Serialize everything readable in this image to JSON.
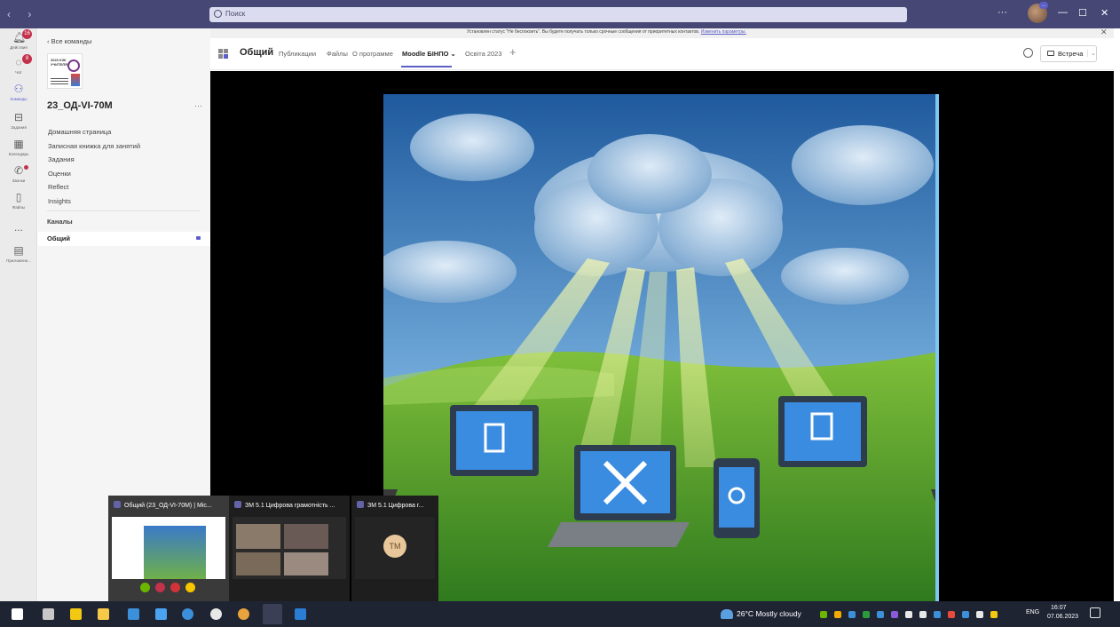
{
  "window": {
    "search_placeholder": "Поиск",
    "nav_arrows": "‹ ›",
    "more": "···",
    "avatar_badge": "...",
    "minimize": "—",
    "maximize": "☐",
    "close": "✕"
  },
  "rail": [
    {
      "label": "Действия",
      "icon": "bell-icon",
      "badge": "16"
    },
    {
      "label": "Чат",
      "icon": "chat-icon",
      "badge": "8"
    },
    {
      "label": "Команды",
      "icon": "teams-icon",
      "active": true
    },
    {
      "label": "Задания",
      "icon": "assignments-icon"
    },
    {
      "label": "Календарь",
      "icon": "calendar-icon"
    },
    {
      "label": "Звонки",
      "icon": "phone-icon",
      "dot": true
    },
    {
      "label": "Файлы",
      "icon": "file-icon"
    },
    {
      "label": "...",
      "icon": "more-icon"
    },
    {
      "label": "Приложени...",
      "icon": "apps-icon"
    }
  ],
  "sidebar": {
    "back_label": "‹  Все команды",
    "team_logo_text": "2023 КЗК УЧИТЕЛЯ",
    "team_name": "23_ОД-VI-70М",
    "team_more": "···",
    "nav_items": [
      "Домашняя страница",
      "Записная книжка для занятий",
      "Задания",
      "Оценки",
      "Reflect",
      "Insights"
    ],
    "channels_label": "Каналы",
    "active_channel": "Общий"
  },
  "banner": {
    "text": "Установлен статус \"Не беспокоить\". Вы будете получать только срочные сообщения от приоритетных контактов.",
    "link": "Изменить параметры.",
    "close": "✕"
  },
  "header": {
    "channel_title": "Общий",
    "tabs": [
      {
        "label": "Публикации"
      },
      {
        "label": "Файлы"
      },
      {
        "label": "О программе"
      },
      {
        "label": "Moodle БІНПО ⌄",
        "active": true
      },
      {
        "label": "Освіта 2023"
      }
    ],
    "add_tab": "+",
    "meeting_button": "Встреча",
    "meeting_dropdown": "⌄"
  },
  "previews": [
    {
      "title": "Общий (23_ОД-VI-70М) | Mic...",
      "active": true
    },
    {
      "title": "ЗМ 5.1 Цифрова грамотність ..."
    },
    {
      "title": "ЗМ 5.1 Цифрова г...",
      "avatar": "ТМ"
    }
  ],
  "preview_controls": [
    {
      "color": "#6bb700"
    },
    {
      "color": "#c4314b"
    },
    {
      "color": "#d13438"
    },
    {
      "color": "#f7c600"
    }
  ],
  "taskbar": {
    "weather": "26°C  Mostly cloudy",
    "language": "ENG",
    "time": "16:07",
    "date": "07.06.2023",
    "icons": [
      {
        "name": "windows-start-icon",
        "color": "#ffffff"
      },
      {
        "name": "task-view-icon",
        "color": "#c8c8c8"
      },
      {
        "name": "store-icon",
        "color": "#f2c811"
      },
      {
        "name": "file-explorer-icon",
        "color": "#f7c948"
      },
      {
        "name": "mail-icon",
        "color": "#3c8fd9"
      },
      {
        "name": "snipping-tool-icon",
        "color": "#4aa3f0"
      },
      {
        "name": "vpn-icon",
        "color": "#3c8fd9"
      },
      {
        "name": "record-icon",
        "color": "#e8e8e8"
      },
      {
        "name": "chrome-icon",
        "color": "#e8a33c"
      },
      {
        "name": "teams-icon",
        "color": "#6264a7"
      },
      {
        "name": "word-icon",
        "color": "#2b7cd3"
      }
    ],
    "tray_colors": [
      "#6bb700",
      "#f2a900",
      "#3c8fd9",
      "#2b9a3c",
      "#3c8fd9",
      "#8a5ad9",
      "#e8e8e8",
      "#e8e8e8",
      "#3c8fd9",
      "#e84a3c",
      "#3c8fd9",
      "#e8e8e8",
      "#f2c811"
    ]
  }
}
